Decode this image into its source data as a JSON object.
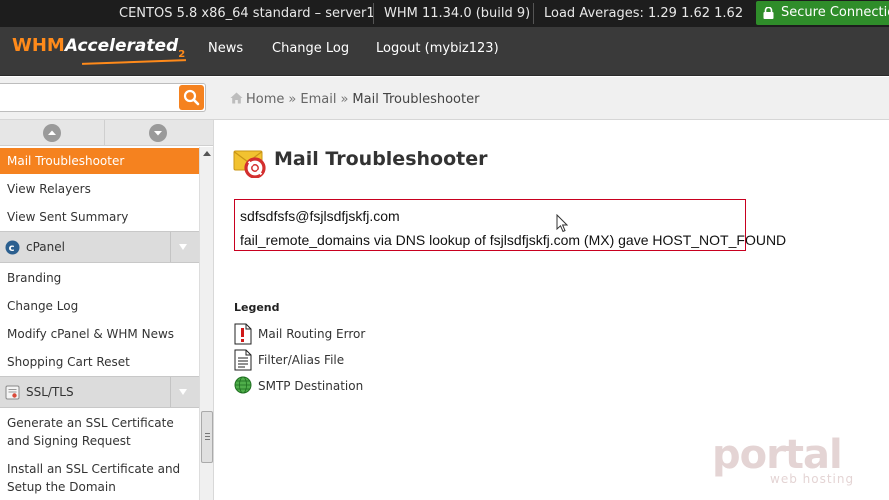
{
  "statusbar": {
    "server": "CENTOS 5.8 x86_64 standard – server1",
    "version": "WHM 11.34.0 (build 9)",
    "load": "Load Averages: 1.29 1.62 1.62",
    "secure": "Secure Connection"
  },
  "header": {
    "logo_whm": "WHM",
    "logo_accelerated": "Accelerated",
    "logo_version": "2",
    "nav": [
      "News",
      "Change Log",
      "Logout (mybiz123)"
    ]
  },
  "search": {
    "value": ""
  },
  "breadcrumb": {
    "home": "Home",
    "section": "Email",
    "current": "Mail Troubleshooter",
    "separator": "»"
  },
  "sidebar": {
    "email_items": [
      "Mail Troubleshooter",
      "View Relayers",
      "View Sent Summary"
    ],
    "cpanel_group": "cPanel",
    "cpanel_items": [
      "Branding",
      "Change Log",
      "Modify cPanel & WHM News",
      "Shopping Cart Reset"
    ],
    "ssl_group": "SSL/TLS",
    "ssl_items": [
      "Generate an SSL Certificate and Signing Request",
      "Install an SSL Certificate and Setup the Domain"
    ]
  },
  "page": {
    "title": "Mail Troubleshooter",
    "result_lines": [
      "sdfsdfsfs@fsjlsdfjskfj.com",
      "fail_remote_domains via DNS lookup of fsjlsdfjskfj.com (MX) gave HOST_NOT_FOUND"
    ],
    "legend_title": "Legend",
    "legend": [
      "Mail Routing Error",
      "Filter/Alias File",
      "SMTP Destination"
    ]
  },
  "watermark": {
    "word": "portal",
    "sub": "web hosting"
  },
  "colors": {
    "accent": "#f5821f",
    "error_border": "#c8001f",
    "secure": "#2f8d2a",
    "header": "#3a3a3a",
    "statusbar": "#1d1d1d"
  }
}
